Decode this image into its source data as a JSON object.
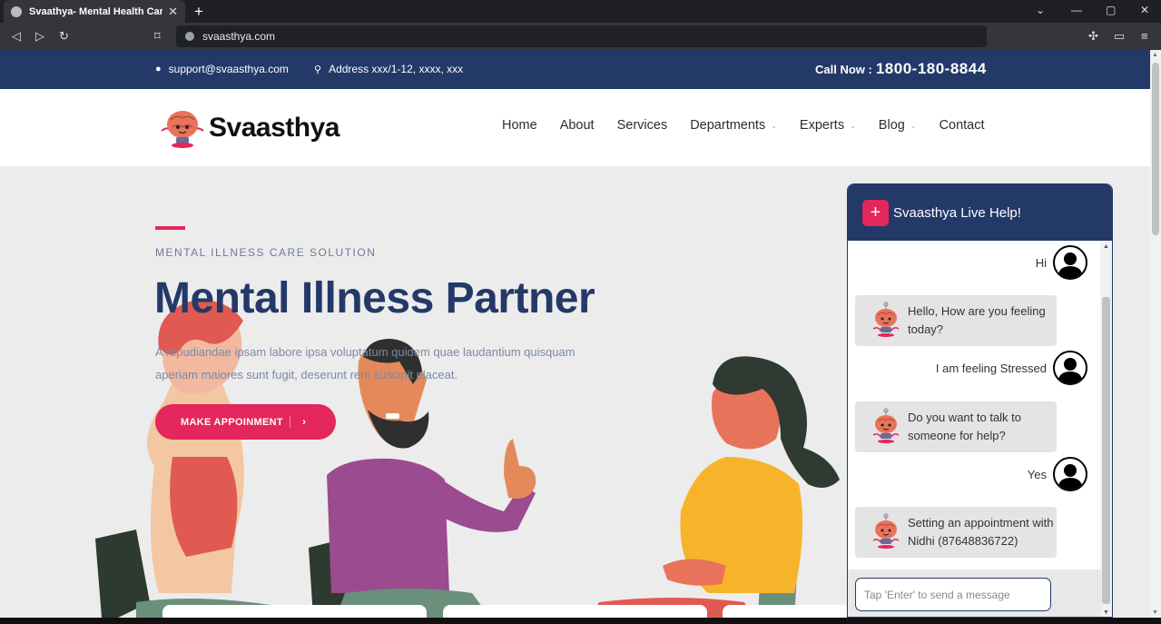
{
  "browser": {
    "tab_title": "Svaathya- Mental Health Care",
    "tab_close": "✕",
    "new_tab": "+",
    "url": "svaasthya.com"
  },
  "topbar": {
    "email": "support@svaasthya.com",
    "address": "Address xxx/1-12, xxxx, xxx",
    "call_label": "Call Now :",
    "call_number": "1800-180-8844"
  },
  "header": {
    "logo_text": "Svaasthya",
    "nav": [
      {
        "label": "Home"
      },
      {
        "label": "About"
      },
      {
        "label": "Services"
      },
      {
        "label": "Departments",
        "dropdown": true
      },
      {
        "label": "Experts",
        "dropdown": true
      },
      {
        "label": "Blog",
        "dropdown": true
      },
      {
        "label": "Contact"
      }
    ]
  },
  "hero": {
    "kicker": "MENTAL ILLNESS CARE SOLUTION",
    "title": "Mental Illness Partner",
    "description": "A repudiandae ipsam labore ipsa voluptatum quidem quae laudantium quisquam aperiam maiores sunt fugit, deserunt rem suscipit placeat.",
    "button_label": "MAKE APPOINMENT"
  },
  "chat": {
    "title": "Svaasthya Live Help!",
    "messages": [
      {
        "from": "user",
        "text": "Hi"
      },
      {
        "from": "bot",
        "text": "Hello, How are you feeling today?"
      },
      {
        "from": "user",
        "text": "I am feeling Stressed"
      },
      {
        "from": "bot",
        "text": "Do you want to talk to someone for help?"
      },
      {
        "from": "user",
        "text": "Yes"
      },
      {
        "from": "bot",
        "text": "Setting an appointment with Nidhi (87648836722)"
      }
    ],
    "input_placeholder": "Tap 'Enter' to send a message"
  },
  "colors": {
    "navy": "#233968",
    "accent": "#e3265b"
  }
}
